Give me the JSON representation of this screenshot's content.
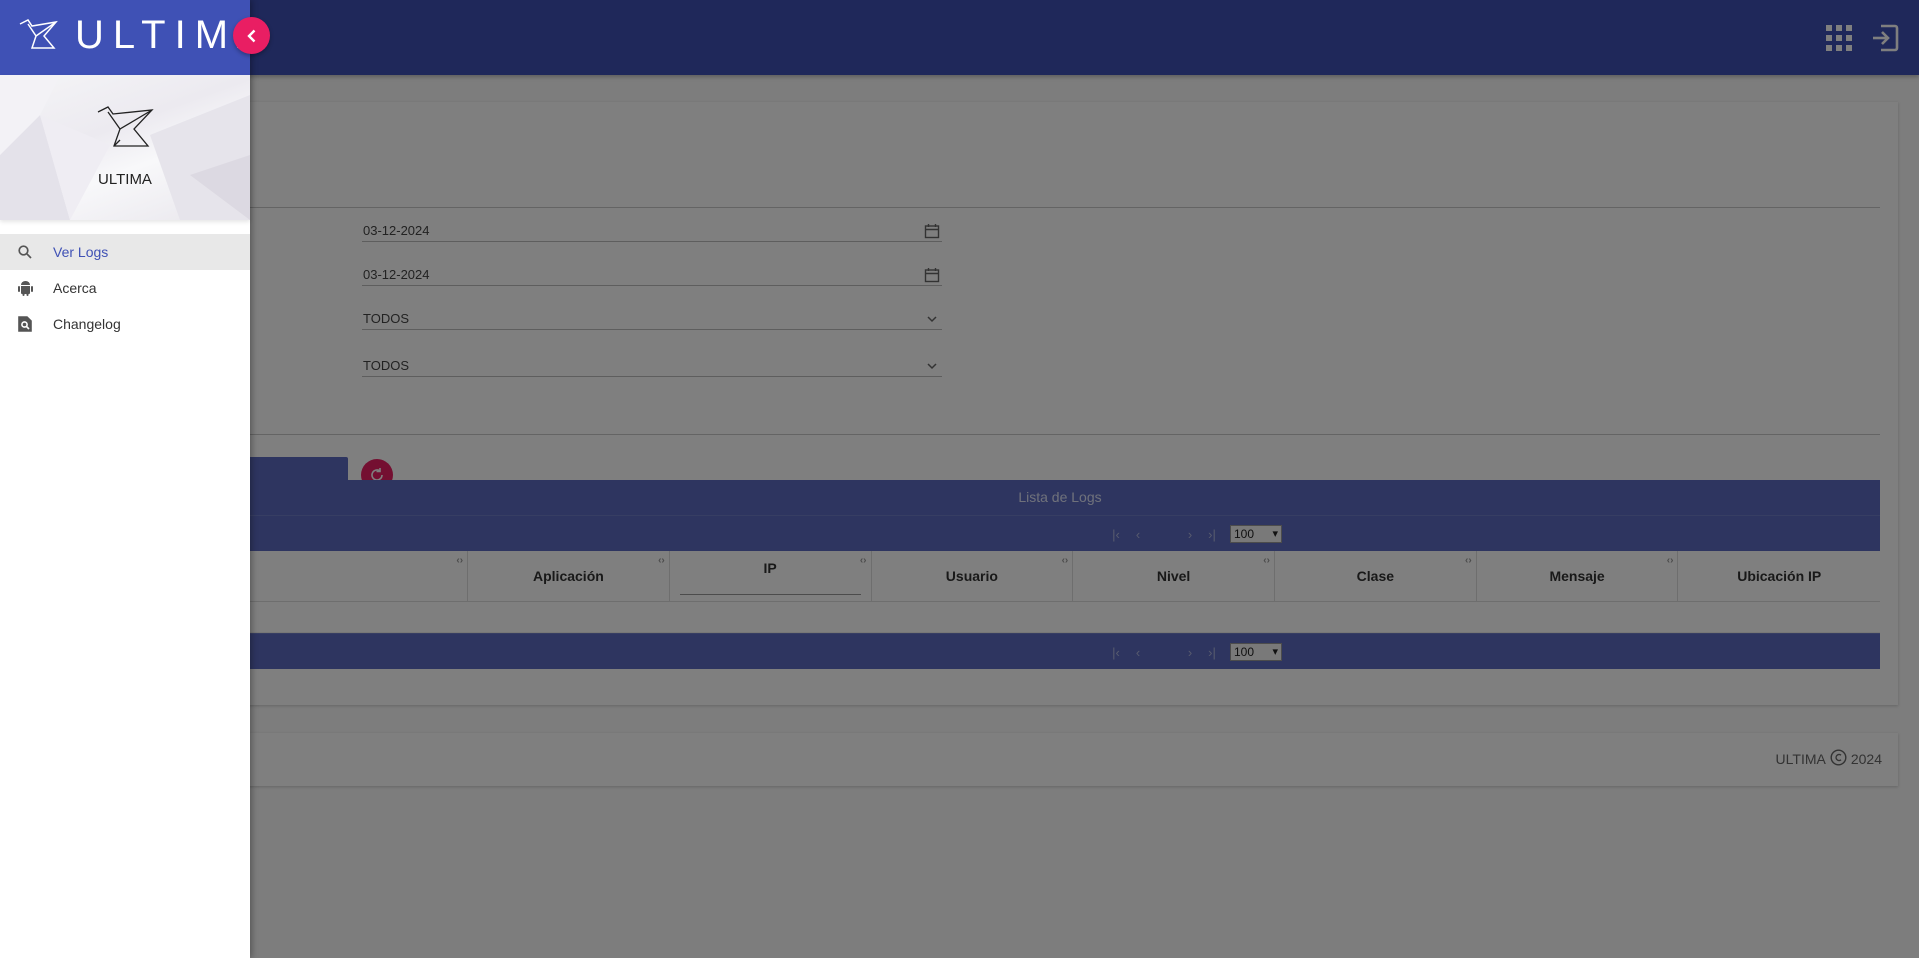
{
  "app": {
    "brand": "ULTIMA"
  },
  "profile": {
    "name": "ULTIMA"
  },
  "sidebar": {
    "items": [
      {
        "label": "Ver Logs",
        "icon": "search-icon",
        "active": true
      },
      {
        "label": "Acerca",
        "icon": "android-icon",
        "active": false
      },
      {
        "label": "Changelog",
        "icon": "find-in-page-icon",
        "active": false
      }
    ]
  },
  "filters": {
    "date_from": "03-12-2024",
    "date_to": "03-12-2024",
    "select1": "TODOS",
    "select2": "TODOS"
  },
  "table": {
    "caption": "Lista de Logs",
    "page_size": "100",
    "columns": [
      "Aplicación",
      "IP",
      "Usuario",
      "Nivel",
      "Clase",
      "Mensaje",
      "Ubicación IP"
    ]
  },
  "footer": {
    "brand": "ULTIMA",
    "year": "2024"
  },
  "colors": {
    "primary": "#3f51b5",
    "accent": "#e91e63"
  }
}
